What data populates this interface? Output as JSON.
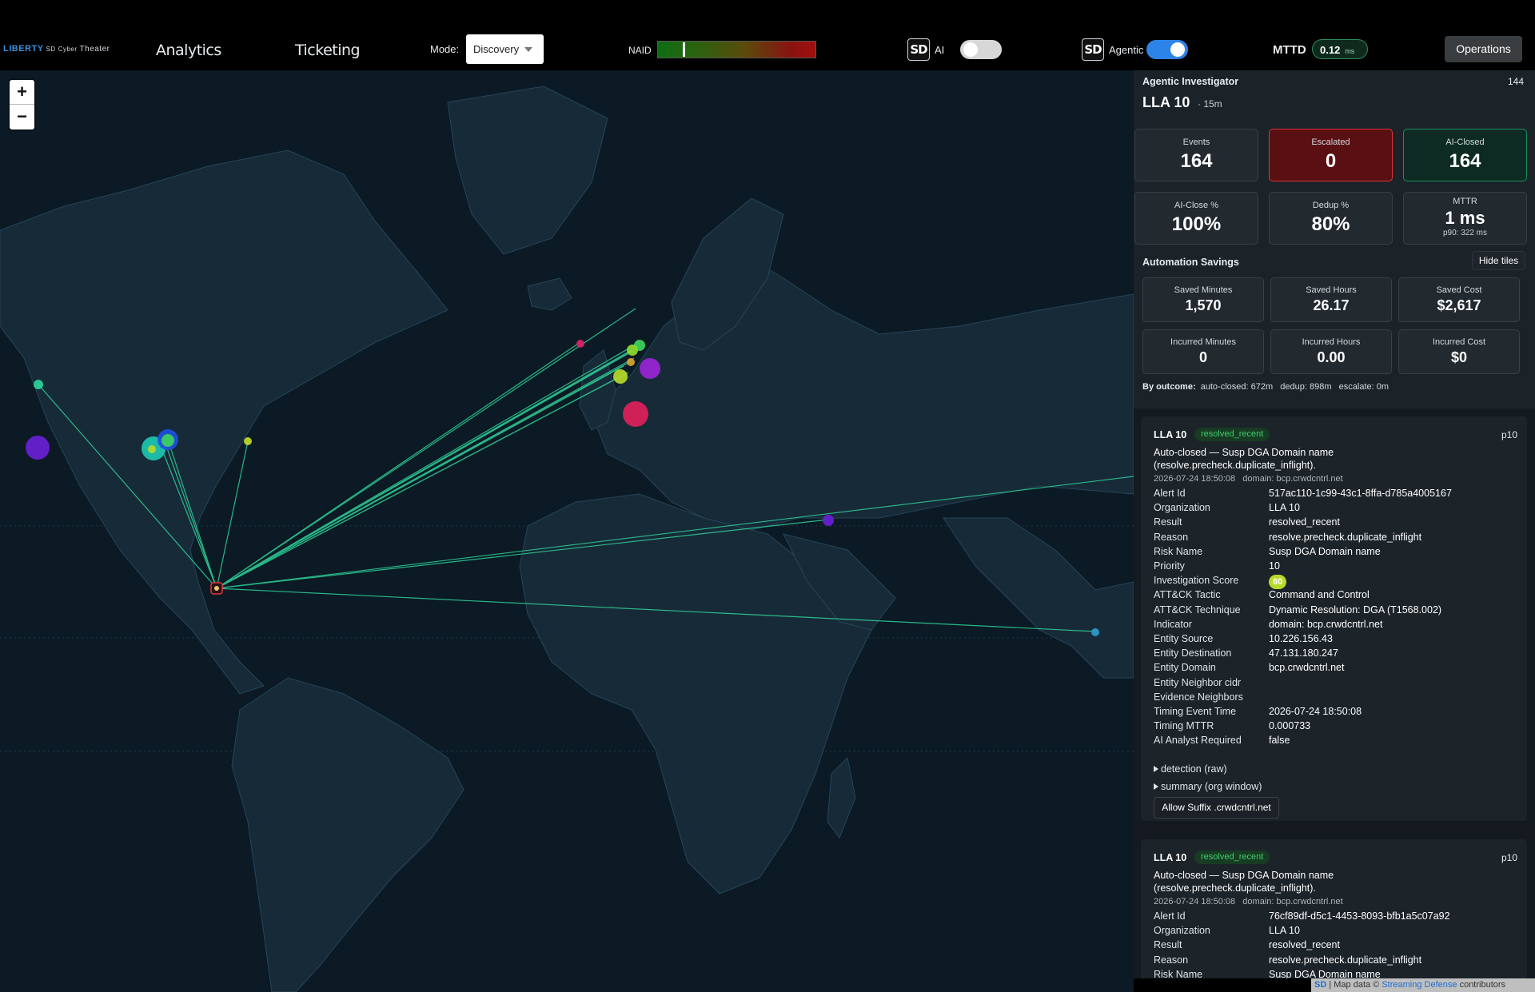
{
  "brand": {
    "name": "LIBERTY",
    "sub": "SD",
    "sub2": "Cyber",
    "product": "Theater"
  },
  "nav": {
    "analytics": "Analytics",
    "ticketing": "Ticketing"
  },
  "mode": {
    "label": "Mode:",
    "value": "Discovery"
  },
  "naid": {
    "label": "NAID",
    "level": 0.16
  },
  "sd_ai": {
    "badge": "SD",
    "label": "AI",
    "enabled": false
  },
  "sd_agentic": {
    "badge": "SD",
    "label": "Agentic",
    "enabled": true
  },
  "mttd": {
    "label": "MTTD",
    "value": "0.12",
    "unit": "ms"
  },
  "operations_label": "Operations",
  "map": {
    "zoom_in": "+",
    "zoom_out": "−",
    "attribution": {
      "sd": "SD",
      "text": " | Map data © ",
      "link": "Streaming Defense",
      "suffix": " contributors"
    }
  },
  "panel": {
    "title": "Agentic Investigator",
    "count": "144",
    "org": "LLA 10",
    "window": "· 15m",
    "tiles": {
      "events": {
        "label": "Events",
        "value": "164"
      },
      "escalated": {
        "label": "Escalated",
        "value": "0"
      },
      "ai_closed": {
        "label": "AI-Closed",
        "value": "164"
      },
      "ai_close_pct": {
        "label": "AI-Close %",
        "value": "100%"
      },
      "dedup_pct": {
        "label": "Dedup %",
        "value": "80%"
      },
      "mttr": {
        "label": "MTTR",
        "value": "1 ms",
        "sub": "p90: 322 ms"
      }
    },
    "savings": {
      "title": "Automation Savings",
      "hide_label": "Hide tiles",
      "saved_minutes": {
        "label": "Saved Minutes",
        "value": "1,570"
      },
      "saved_hours": {
        "label": "Saved Hours",
        "value": "26.17"
      },
      "saved_cost": {
        "label": "Saved Cost",
        "value": "$2,617"
      },
      "incurred_minutes": {
        "label": "Incurred Minutes",
        "value": "0"
      },
      "incurred_hours": {
        "label": "Incurred Hours",
        "value": "0.00"
      },
      "incurred_cost": {
        "label": "Incurred Cost",
        "value": "$0"
      }
    },
    "by_outcome": {
      "label": "By outcome:",
      "text": "auto-closed: 672m   dedup: 898m   escalate: 0m"
    }
  },
  "cards": [
    {
      "org": "LLA 10",
      "badge": "resolved_recent",
      "priority": "p10",
      "summary": "Auto-closed — Susp DGA Domain name (resolve.precheck.duplicate_inflight).",
      "meta": "2026-07-24 18:50:08   domain: bcp.crwdcntrl.net",
      "fields": [
        {
          "k": "Alert Id",
          "v": "517ac110-1c99-43c1-8ffa-d785a4005167"
        },
        {
          "k": "Organization",
          "v": "LLA 10"
        },
        {
          "k": "Result",
          "v": "resolved_recent"
        },
        {
          "k": "Reason",
          "v": "resolve.precheck.duplicate_inflight"
        },
        {
          "k": "Risk Name",
          "v": "Susp DGA Domain name"
        },
        {
          "k": "Priority",
          "v": "10"
        },
        {
          "k": "Investigation Score",
          "v": "60"
        },
        {
          "k": "ATT&CK Tactic",
          "v": "Command and Control"
        },
        {
          "k": "ATT&CK Technique",
          "v": "Dynamic Resolution: DGA (T1568.002)"
        },
        {
          "k": "Indicator",
          "v": "domain: bcp.crwdcntrl.net"
        },
        {
          "k": "Entity Source",
          "v": "10.226.156.43"
        },
        {
          "k": "Entity Destination",
          "v": "47.131.180.247"
        },
        {
          "k": "Entity Domain",
          "v": "bcp.crwdcntrl.net"
        },
        {
          "k": "Entity Neighbor cidr",
          "v": ""
        },
        {
          "k": "Evidence Neighbors",
          "v": ""
        },
        {
          "k": "Timing Event Time",
          "v": "2026-07-24 18:50:08"
        },
        {
          "k": "Timing MTTR",
          "v": "0.000733"
        },
        {
          "k": "AI Analyst Required",
          "v": "false"
        }
      ],
      "detection": "detection (raw)",
      "summary_window": "summary (org window)",
      "allow": "Allow Suffix .crwdcntrl.net"
    },
    {
      "org": "LLA 10",
      "badge": "resolved_recent",
      "priority": "p10",
      "summary": "Auto-closed — Susp DGA Domain name (resolve.precheck.duplicate_inflight).",
      "meta": "2026-07-24 18:50:08   domain: bcp.crwdcntrl.net",
      "fields": [
        {
          "k": "Alert Id",
          "v": "76cf89df-d5c1-4453-8093-bfb1a5c07a92"
        },
        {
          "k": "Organization",
          "v": "LLA 10"
        },
        {
          "k": "Result",
          "v": "resolved_recent"
        },
        {
          "k": "Reason",
          "v": "resolve.precheck.duplicate_inflight"
        },
        {
          "k": "Risk Name",
          "v": "Susp DGA Domain name"
        }
      ]
    }
  ],
  "colors": {
    "accent": "#2d84e8",
    "arc": "#2fd39a",
    "escalated": "#e0343b",
    "closed": "#1e8f5f",
    "map_bg": "#0b1a24",
    "land": "#172a38"
  }
}
